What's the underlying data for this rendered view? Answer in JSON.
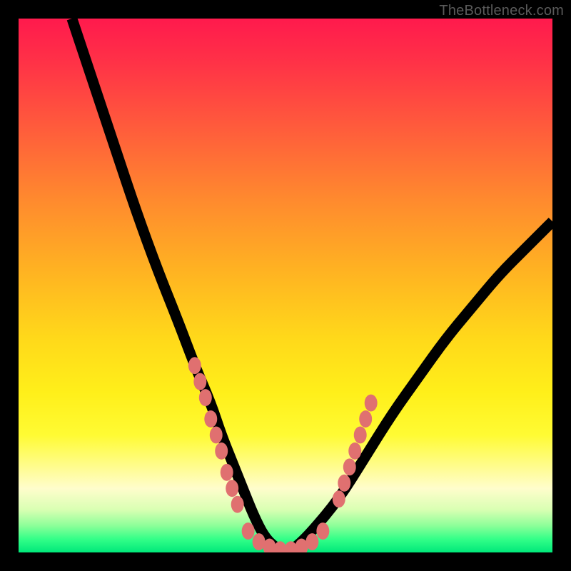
{
  "watermark": "TheBottleneck.com",
  "chart_data": {
    "type": "line",
    "title": "",
    "xlabel": "",
    "ylabel": "",
    "xlim": [
      0,
      100
    ],
    "ylim": [
      0,
      100
    ],
    "grid": false,
    "background_gradient": {
      "top_color": "#ff1a4d",
      "bottom_color": "#00e87a",
      "meaning": "red high bottleneck, green low bottleneck"
    },
    "series": [
      {
        "name": "bottleneck-curve",
        "stroke": "#000000",
        "x": [
          10,
          14,
          18,
          22,
          26,
          30,
          33,
          36,
          38,
          40,
          42,
          44,
          46,
          48,
          50,
          52,
          55,
          60,
          65,
          70,
          75,
          80,
          85,
          90,
          95,
          100
        ],
        "values": [
          100,
          88,
          76,
          64,
          53,
          43,
          35,
          28,
          22,
          17,
          12,
          7,
          3,
          1,
          0,
          1,
          4,
          10,
          18,
          26,
          33,
          40,
          46,
          52,
          57,
          62
        ]
      }
    ],
    "markers": {
      "name": "highlighted-points",
      "color": "#e07070",
      "left_cluster": [
        [
          33,
          35
        ],
        [
          34,
          32
        ],
        [
          35,
          29
        ],
        [
          36,
          25
        ],
        [
          37,
          22
        ],
        [
          38,
          19
        ],
        [
          39,
          15
        ],
        [
          40,
          12
        ],
        [
          41,
          9
        ]
      ],
      "valley": [
        [
          43,
          4
        ],
        [
          45,
          2
        ],
        [
          47,
          1
        ],
        [
          49,
          0.5
        ],
        [
          51,
          0.5
        ],
        [
          53,
          1
        ],
        [
          55,
          2
        ],
        [
          57,
          4
        ]
      ],
      "right_cluster": [
        [
          60,
          10
        ],
        [
          61,
          13
        ],
        [
          62,
          16
        ],
        [
          63,
          19
        ],
        [
          64,
          22
        ],
        [
          65,
          25
        ],
        [
          66,
          28
        ]
      ]
    }
  }
}
